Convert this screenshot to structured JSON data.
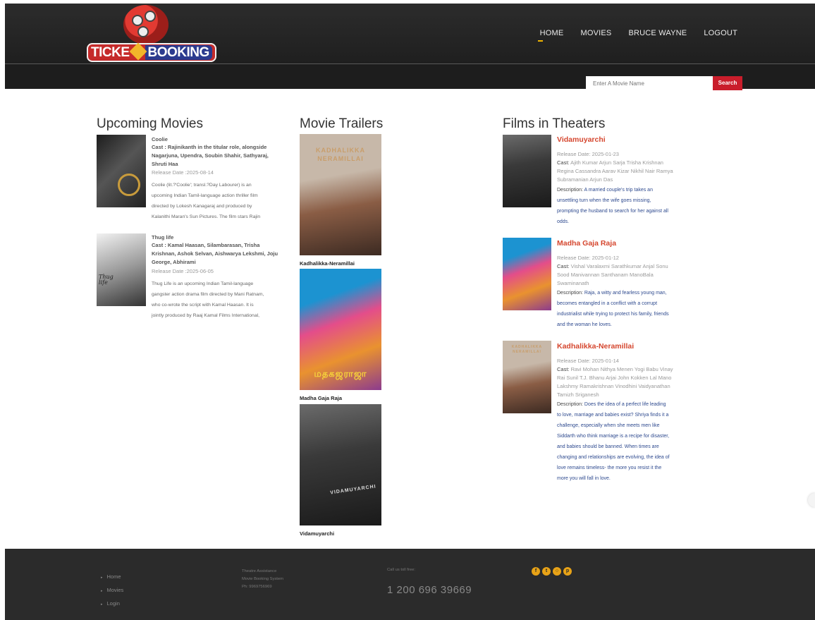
{
  "brand": {
    "logo_text_a": "TICKE",
    "logo_text_b": "BOOKING"
  },
  "nav": [
    {
      "label": "HOME"
    },
    {
      "label": "MOVIES"
    },
    {
      "label": "BRUCE WAYNE"
    },
    {
      "label": "LOGOUT"
    }
  ],
  "search": {
    "placeholder": "Enter A Movie Name",
    "button_label": "Search"
  },
  "upcoming": {
    "heading": "Upcoming Movies",
    "items": [
      {
        "title": "Coolie",
        "cast_lines": [
          "Cast : Rajinikanth in the titular role, alongside",
          "Nagarjuna, Upendra, Soubin Shahir, Sathyaraj,",
          "Shruti Haa"
        ],
        "release": "Release Date :2025-08-14",
        "desc_lines": [
          "Coolie (lit.?'Coolie'; transl.?Day Labourer) is an",
          "upcoming Indian Tamil-language action thriller film",
          "directed by Lokesh Kanagaraj and produced by",
          "Kalanithi Maran's Sun Pictures. The film stars Rajin"
        ]
      },
      {
        "title": "Thug life",
        "cast_lines": [
          "Cast : Kamal Haasan, Silambarasan, Trisha",
          "Krishnan, Ashok Selvan, Aishwarya Lekshmi, Joju",
          "George, Abhirami"
        ],
        "release": "Release Date :2025-06-05",
        "desc_lines": [
          "Thug Life is an upcoming Indian Tamil-language",
          "gangster action drama film directed by Mani Ratnam,",
          "who co-wrote the script with Kamal Haasan. It is",
          "jointly produced by Raaj Kamal Films International,"
        ]
      }
    ]
  },
  "trailers": {
    "heading": "Movie Trailers",
    "items": [
      {
        "caption": "Kadhalikka-Neramillai",
        "poster_text_a": "KADHALIKKA",
        "poster_text_b": "NERAMILLAI"
      },
      {
        "caption": "Madha Gaja Raja",
        "poster_text_a": "மதகஜராஜா"
      },
      {
        "caption": "Vidamuyarchi",
        "poster_text_a": "VIDAMUYARCHI"
      }
    ]
  },
  "theaters": {
    "heading": "Films in Theaters",
    "items": [
      {
        "title": "Vidamuyarchi",
        "release": "Release Date: 2025-01-23",
        "cast_label": "Cast:",
        "cast_lines": [
          " Ajith Kumar Arjun Sarja Trisha Krishnan",
          "Regina Cassandra Aarav Kizar Nikhil Nair Ramya",
          "Subramanian Arjun Das"
        ],
        "desc_label": "Description:",
        "desc_lines": [
          " A married couple's trip takes an",
          "unsettling turn when the wife goes missing,",
          "prompting the husband to search for her against all",
          "odds."
        ]
      },
      {
        "title": "Madha Gaja Raja",
        "release": "Release Date: 2025-01-12",
        "cast_label": "Cast:",
        "cast_lines": [
          " Vishal Varalaxmi Sarathkumar Anjal Sonu",
          "Sood Manivannan Santhanam ManoBala",
          "Swaminanath"
        ],
        "desc_label": "Description:",
        "desc_lines": [
          " Raja, a witty and fearless young man,",
          "becomes entangled in a conflict with a corrupt",
          "industrialist while trying to protect his family, friends",
          "and the woman he loves."
        ]
      },
      {
        "title": "Kadhalikka-Neramillai",
        "release": "Release Date: 2025-01-14",
        "cast_label": "Cast:",
        "cast_lines": [
          " Ravi Mohan Nithya Menen Yogi Babu Vinay",
          "Rai Sunil T.J. Bhanu Arjai John Kokken Lal Mano",
          "Lakshmy Ramakrishnan Vinodhini Vaidyanathan",
          "Tamizh Sriganesh"
        ],
        "desc_label": "Description:",
        "desc_lines": [
          " Does the idea of a perfect life leading",
          "to love, marriage and babies exist? Shriya finds it a",
          "challenge, especially when she meets men like",
          "Siddarth who think marriage is a recipe for disaster,",
          "and babies should be banned. When times are",
          "changing and relationships are evolving, the idea of",
          "love remains timeless- the more you resist it the",
          "more you will fall in love."
        ]
      }
    ]
  },
  "footer": {
    "links": [
      "Home",
      "Movies",
      "Login"
    ],
    "address_lines": [
      "Theatre Assistance",
      "Movie Booking System",
      "Ph: 9969756969"
    ],
    "call_label": "Call us toll free:",
    "phone": "1 200 696 39669",
    "social_icons": [
      "facebook-icon",
      "twitter-icon",
      "globe-icon",
      "pinterest-icon"
    ]
  },
  "colors": {
    "accent_red": "#c91d2b",
    "accent_yellow": "#f0b400",
    "title_orange": "#d5462e",
    "desc_blue": "#2e4a8f"
  }
}
